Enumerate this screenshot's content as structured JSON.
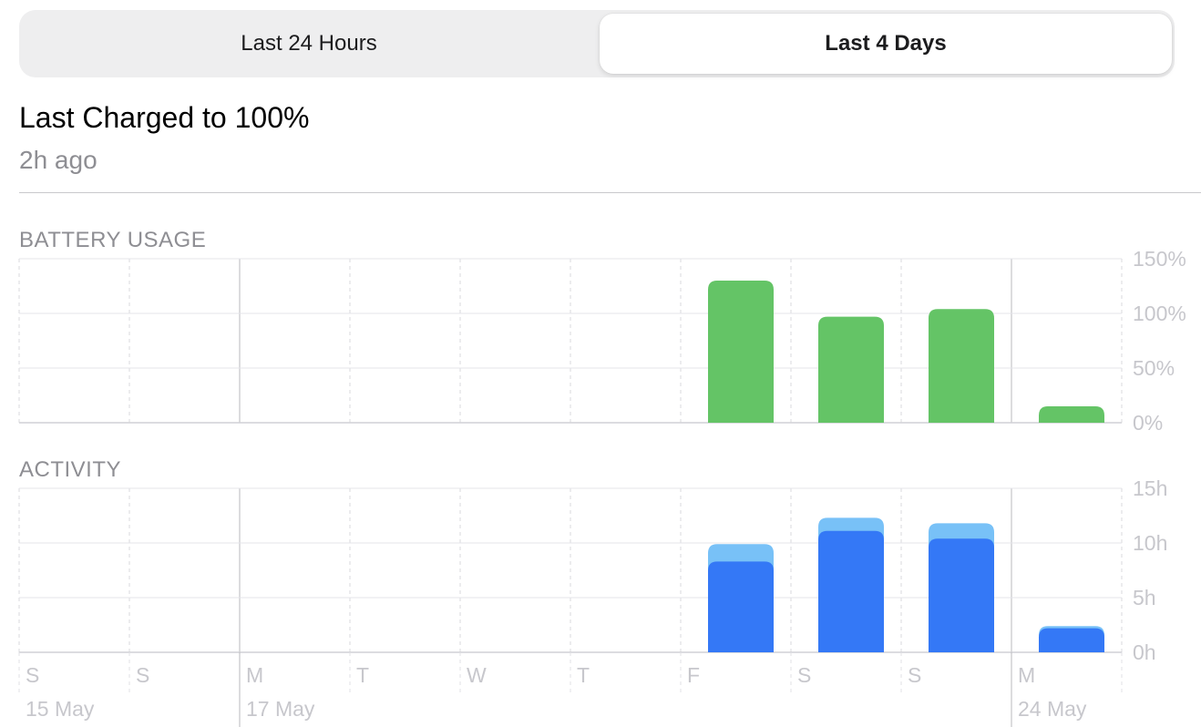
{
  "segmented_control": {
    "options": [
      "Last 24 Hours",
      "Last 4 Days"
    ],
    "selected": "Last 4 Days"
  },
  "last_charged": {
    "title": "Last Charged to 100%",
    "subtitle": "2h ago"
  },
  "sections": {
    "battery_label": "BATTERY USAGE",
    "activity_label": "ACTIVITY"
  },
  "colors": {
    "battery_bar": "#64c466",
    "activity_screen_on": "#3478f6",
    "activity_screen_off": "#78c1f7",
    "grid": "#e5e5ea",
    "axis_text": "#c7c7cc",
    "date_text": "#c7c7cc"
  },
  "chart_data": [
    {
      "type": "bar",
      "title": "BATTERY USAGE",
      "categories": [
        "S",
        "S",
        "M",
        "T",
        "W",
        "T",
        "F",
        "S",
        "S",
        "M"
      ],
      "values": [
        0,
        0,
        0,
        0,
        0,
        0,
        130,
        97,
        104,
        15
      ],
      "ylim": [
        0,
        150
      ],
      "yticks": [
        0,
        50,
        100,
        150
      ],
      "ytick_labels": [
        "0%",
        "50%",
        "100%",
        "150%"
      ],
      "grid": true
    },
    {
      "type": "bar",
      "stacked": true,
      "title": "ACTIVITY",
      "categories": [
        "S",
        "S",
        "M",
        "T",
        "W",
        "T",
        "F",
        "S",
        "S",
        "M"
      ],
      "series": [
        {
          "values": [
            0,
            0,
            0,
            0,
            0,
            0,
            8.3,
            11.1,
            10.4,
            2.2
          ]
        },
        {
          "values": [
            0,
            0,
            0,
            0,
            0,
            0,
            1.6,
            1.2,
            1.4,
            0.2
          ]
        }
      ],
      "ylim": [
        0,
        15
      ],
      "yticks": [
        0,
        5,
        10,
        15
      ],
      "ytick_labels": [
        "0h",
        "5h",
        "10h",
        "15h"
      ],
      "grid": true
    }
  ],
  "x_axis": {
    "day_letters": [
      "S",
      "S",
      "M",
      "T",
      "W",
      "T",
      "F",
      "S",
      "S",
      "M"
    ],
    "date_labels": [
      {
        "index": 0,
        "text": "15 May"
      },
      {
        "index": 2,
        "text": "17 May"
      },
      {
        "index": 9,
        "text": "24 May"
      }
    ]
  }
}
